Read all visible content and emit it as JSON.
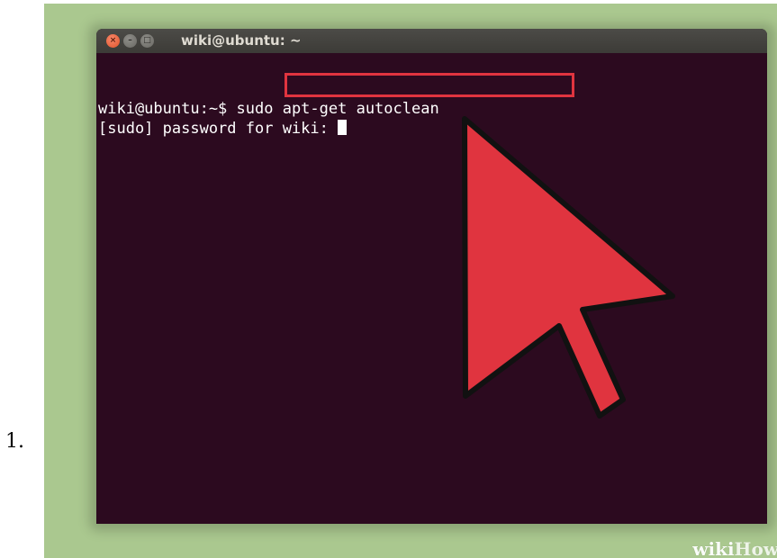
{
  "list": {
    "number": "1."
  },
  "window": {
    "title": "wiki@ubuntu: ~",
    "close_glyph": "×",
    "minimize_glyph": "–",
    "maximize_glyph": "□"
  },
  "terminal": {
    "prompt": "wiki@ubuntu:~$ ",
    "command": "sudo apt-get autoclean",
    "password_prompt": "[sudo] password for wiki: "
  },
  "annotation": {
    "highlight_color": "#e0343f",
    "arrow_color": "#e0343f",
    "arrow_icon": "mouse-pointer-arrow-icon"
  },
  "watermark": {
    "part1": "wiki",
    "part2": "How"
  },
  "colors": {
    "background": "#aac88f",
    "terminal_bg": "#2c0a1f",
    "titlebar": "#3c3b37"
  }
}
